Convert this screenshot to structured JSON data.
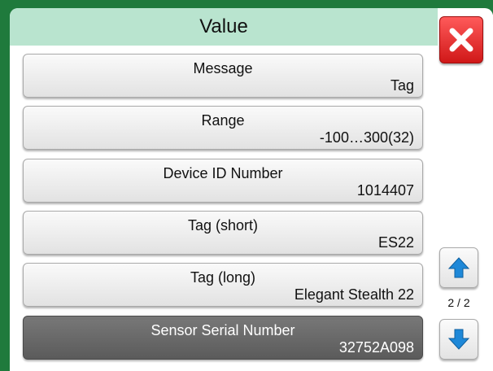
{
  "header": {
    "title": "Value"
  },
  "close": {
    "icon": "close-icon",
    "color": "#e02525"
  },
  "rows": [
    {
      "label": "Message",
      "value": "Tag"
    },
    {
      "label": "Range",
      "value": "-100…300(32)"
    },
    {
      "label": "Device ID Number",
      "value": "1014407"
    },
    {
      "label": "Tag (short)",
      "value": "ES22"
    },
    {
      "label": "Tag (long)",
      "value": "Elegant Stealth 22"
    },
    {
      "label": "Sensor Serial Number",
      "value": "32752A098",
      "selected": true
    }
  ],
  "pager": {
    "indicator": "2 / 2",
    "up_icon": "arrow-up-icon",
    "down_icon": "arrow-down-icon",
    "arrow_color": "#1e88d8"
  },
  "colors": {
    "frame": "#1f7a3c",
    "title_bar": "#b9e4cf",
    "selected_row": "#666666"
  }
}
